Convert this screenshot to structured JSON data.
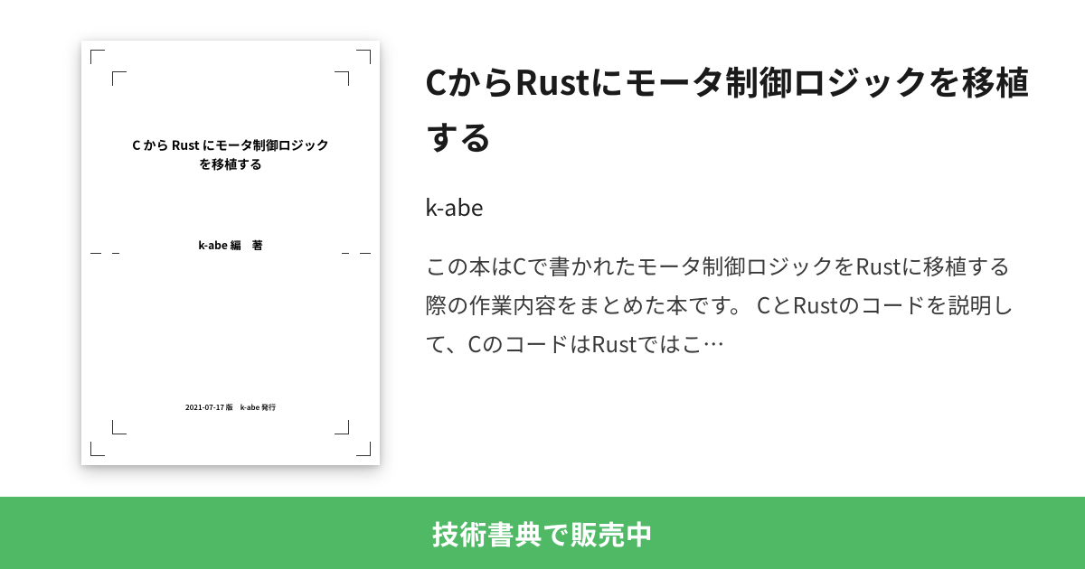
{
  "cover": {
    "title": "C から Rust にモータ制御ロジック\nを移植する",
    "author": "k-abe 編　著",
    "meta": "2021-07-17 版　k-abe 発行"
  },
  "info": {
    "title": "CからRustにモータ制御ロジックを移植する",
    "author": "k-abe",
    "description": "この本はCで書かれたモータ制御ロジックをRustに移植する際の作業内容をまとめた本です。 CとRustのコードを説明して、CのコードはRustではこ…"
  },
  "banner": {
    "label": "技術書典で販売中"
  },
  "colors": {
    "banner_bg": "#4fb966",
    "banner_text": "#ffffff"
  }
}
